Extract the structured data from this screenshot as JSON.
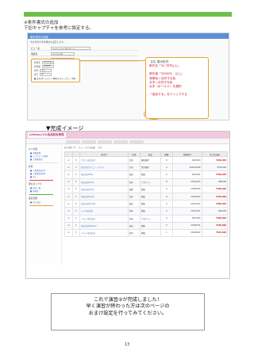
{
  "section": {
    "title": "④条件書式の追加",
    "subtitle": "下記キャプチャを参考に設定する。"
  },
  "screenshot1": {
    "header": "条件書式の追加",
    "note": "次の条件の条件書式を設定します。",
    "rows": [
      {
        "label": "ビュー名",
        "value": "Lifebox(13) 着信ビュー"
      },
      {
        "label": "項目名",
        "value": "売上見込額"
      },
      {
        "label": "入力タイプ",
        "value": "数値"
      }
    ],
    "highlight_rows": [
      {
        "label": "条件名",
        "value": "30万円以上"
      },
      {
        "label": "条件値",
        "value": "300000"
      },
      {
        "label": "条件",
        "value": "以上"
      },
      {
        "label": "文字",
        "value": "赤"
      }
    ],
    "radios": "● 太字(ボールド)  ○ 斜体(イタリック)  ○ 下線",
    "save_label": "保存する",
    "cancel_label": "キャンセル",
    "callout": {
      "head": "【2】表示形式",
      "lines": [
        "条件名「30 万円以上」",
        "",
        "条件値「300000　以上」",
        "背景色＝お好きな色",
        "文字＝お好きな色",
        "太字（ボールド）を選択",
        "",
        "「追加する」をクリックする"
      ]
    }
  },
  "kansei_label": "▼完成イメージ",
  "screenshot2": {
    "logo": "Lifebox(13)商品取扱管理",
    "toolbar": "表示件数: 10 ・ ビュー: 売上見込額 ・ 全件",
    "side": {
      "sections": [
        {
          "title": "マイ分析",
          "items": [
            "■ 予算管理",
            "■ ○○グループ進捗",
            "■ 工程進捗表"
          ]
        },
        {
          "title": "共有",
          "items": [
            "■ 工程進捗表(A)",
            "■ 工程進捗表(B)",
            "■ 売上"
          ]
        },
        {
          "title": "受信ボックス",
          "items": [
            "■ 商品一覧",
            "■ 担当者"
          ]
        },
        {
          "title": "最近使用",
          "items": [
            "■ 売上見込"
          ]
        }
      ]
    },
    "table": {
      "columns": [
        "",
        "",
        "取引先",
        "担当",
        "商品",
        "数量",
        "見積日付",
        "売上見込額"
      ],
      "rows": [
        [
          "☑",
          "✎",
          "ガエモ 株式会社",
          "渋谷",
          "資格取得",
          "6",
          "2010/6/3",
          "¥160,000",
          "red"
        ],
        [
          "☑",
          "✎",
          "株式会社マクニーノテラス",
          "渋谷",
          "青空書斎",
          "4",
          "2010/10/28",
          "¥120,000",
          "normal"
        ],
        [
          "☑",
          "✎",
          "株式会社Elite",
          "田辺",
          "書籍",
          "2",
          "2010/5/1",
          "¥400,000",
          "red"
        ],
        [
          "☑",
          "✎",
          "株式会社Lamp",
          "鈴木",
          "アカウント",
          "8",
          "2011/6/15",
          "¥88,000",
          "normal"
        ],
        [
          "☑",
          "✎",
          "株式会社Lamp",
          "加藤",
          "書籍",
          "3",
          "2010/5/25",
          "¥300,000",
          "red"
        ],
        [
          "☑",
          "✎",
          "株式会社Lamp",
          "渋谷",
          "書籍",
          "8",
          "2010/5/23",
          "¥410,000",
          "red"
        ],
        [
          "☑",
          "✎",
          "株式会社Sumita",
          "田辺",
          "書籍",
          "4",
          "2011/5/27",
          "¥500,000",
          "red"
        ],
        [
          "☑",
          "✎",
          "ルル 株式会社",
          "鈴木",
          "書籍",
          "2",
          "2011/5/11",
          "¥80,000",
          "normal"
        ],
        [
          "☑",
          "✎",
          "アロン 株式会社",
          "渋谷",
          "アカウント",
          "4",
          "2011/6/5",
          "¥500,000",
          "red"
        ],
        [
          "☑",
          "✎",
          "株式会社TailCora",
          "田辺",
          "書籍",
          "5",
          "2010/5/21",
          "¥150,000",
          "red"
        ],
        [
          "☑",
          "✎",
          "アルム 株式会社",
          "鈴木",
          "書籍",
          "1",
          "2010/6/22",
          "¥120,000",
          "red"
        ]
      ]
    }
  },
  "message": [
    "これで演習②が完成しました！",
    "早く演習が終わった方は次のページの",
    "おまけ設定を行ってみてください。"
  ],
  "page_number": "13",
  "colors": {
    "accent_green": "#6cc04a",
    "callout_border": "#e8a337",
    "callout_text": "#c5172c",
    "highlight_red": "#d11b1b"
  }
}
